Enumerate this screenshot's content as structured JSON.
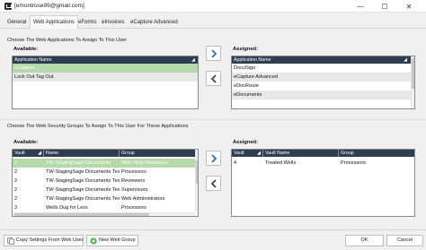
{
  "window": {
    "title": "[emontrose99@gmail.com]",
    "controls": {
      "minimize": "—",
      "maximize": "☐",
      "close": "✕"
    }
  },
  "tabs": [
    {
      "label": "General"
    },
    {
      "label": "Web Applications",
      "active": true
    },
    {
      "label": "eForms"
    },
    {
      "label": "eInvoices"
    },
    {
      "label": "eCapture Advanced"
    }
  ],
  "apps_section": {
    "label": "Choose The Web Applications To Assign To This User",
    "available": {
      "label": "Available:",
      "column": "Application Name",
      "rows": [
        "eCapture",
        "Lock Out Tag Out"
      ]
    },
    "assigned": {
      "label": "Assigned:",
      "column": "Application Name",
      "rows": [
        "DocuSign",
        "eCapture Advanced",
        "eDocRoute",
        "eDocuments"
      ]
    }
  },
  "groups_section": {
    "label": "Choose The Web Security Groups To Assign To This User For These Applications",
    "available": {
      "label": "Available:",
      "columns": [
        "Vault",
        "Name",
        "Group"
      ],
      "rows": [
        [
          "2",
          "TW-StagingSage Documents",
          "Web Only Reviewers"
        ],
        [
          "2",
          "TW-StagingSage Documents Test",
          "Processors"
        ],
        [
          "2",
          "TW-StagingSage Documents Test",
          "Reviewers"
        ],
        [
          "2",
          "TW-StagingSage Documents Test",
          "Supervisors"
        ],
        [
          "2",
          "TW-StagingSage Documents Test",
          "Web Administrators"
        ],
        [
          "3",
          "Wells Dug for Less",
          "Processors"
        ]
      ]
    },
    "assigned": {
      "label": "Assigned:",
      "columns": [
        "Vault",
        "Vault Name",
        "Group"
      ],
      "rows": [
        [
          "4",
          "Treated Wells",
          "Processors"
        ]
      ]
    }
  },
  "footer": {
    "copy_settings": "Copy Settings From Web User",
    "new_web_group": "New Web Group",
    "ok": "OK",
    "cancel": "Cancel"
  },
  "colors": {
    "header": "#2d3e50",
    "selected_row": "#b5d9a8",
    "alt_row": "#e8e8e8",
    "arrow_blue": "#2b6cb0"
  },
  "icons": [
    "app-window-icon",
    "arrow-right-icon",
    "arrow-left-icon",
    "copy-icon",
    "plus-circle-icon",
    "sort-icon"
  ]
}
